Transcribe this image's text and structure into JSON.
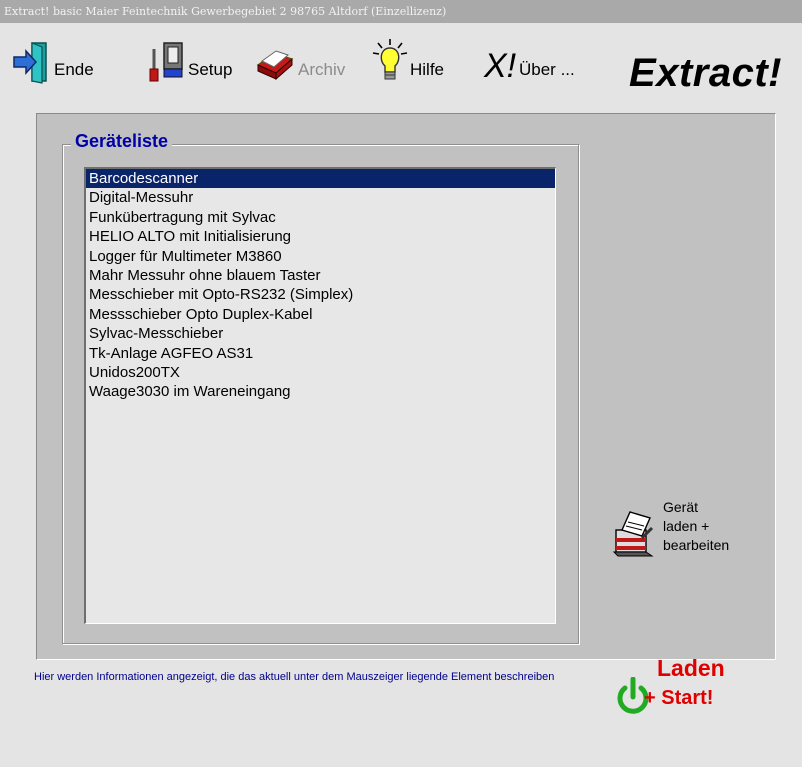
{
  "titlebar": {
    "text": "Extract! basic   Maier Feintechnik  Gewerbegebiet 2  98765 Altdorf   (Einzellizenz)"
  },
  "toolbar": {
    "buttons": [
      {
        "label": "Ende",
        "icon": "exit-door-icon"
      },
      {
        "label": "Setup",
        "icon": "setup-screwdriver-icon"
      },
      {
        "label": "Archiv",
        "icon": "archive-books-icon",
        "disabled": true
      },
      {
        "label": "Hilfe",
        "icon": "lightbulb-icon"
      },
      {
        "label": "Über ...",
        "icon": "xi-logo-icon"
      }
    ],
    "brand": "Extract!"
  },
  "device_list": {
    "title": "Geräteliste",
    "items": [
      "Barcodescanner",
      "Digital-Messuhr",
      "Funkübertragung mit Sylvac",
      "HELIO ALTO  mit Initialisierung",
      "Logger für Multimeter M3860",
      "Mahr Messuhr ohne blauem Taster",
      "Messchieber mit Opto-RS232 (Simplex)",
      "Messschieber Opto Duplex-Kabel",
      "Sylvac-Messchieber",
      "Tk-Anlage AGFEO AS31",
      "Unidos200TX",
      "Waage3030 im Wareneingang"
    ],
    "selected_index": 0
  },
  "load_edit": {
    "line1": "Gerät",
    "line2": "laden +",
    "line3": "bearbeiten"
  },
  "info_text": "Hier werden Informationen angezeigt, die das aktuell unter dem Mauszeiger liegende Element beschreiben",
  "start_button": {
    "line1": "Laden",
    "line2": "+ Start!"
  },
  "colors": {
    "selection": "#0a246a",
    "group_title": "#0000aa",
    "start_text": "#e00000",
    "power_icon": "#22aa22"
  }
}
